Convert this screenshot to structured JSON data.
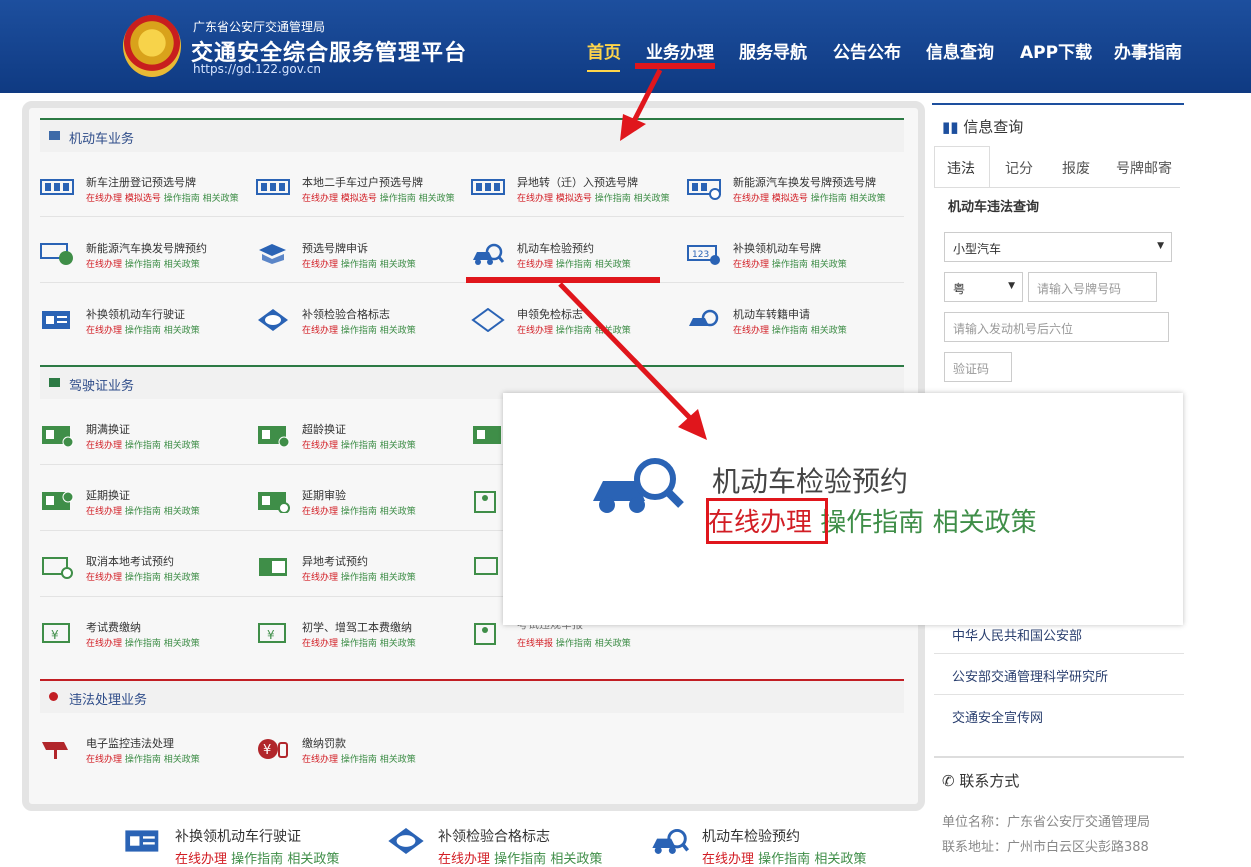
{
  "header": {
    "org": "广东省公安厅交通管理局",
    "title": "交通安全综合服务管理平台",
    "url": "https://gd.122.gov.cn",
    "nav": [
      "首页",
      "业务办理",
      "服务导航",
      "公告公布",
      "信息查询",
      "APP下载",
      "办事指南"
    ]
  },
  "sections": {
    "vehicle": "机动车业务",
    "license": "驾驶证业务",
    "violation": "违法处理业务"
  },
  "links": {
    "online": "在线办理",
    "sim": "模拟选号",
    "guide": "操作指南",
    "policy": "相关政策",
    "report": "在线举报"
  },
  "vehicle_items": [
    "新车注册登记预选号牌",
    "本地二手车过户预选号牌",
    "异地转（迁）入预选号牌",
    "新能源汽车换发号牌预选号牌",
    "新能源汽车换发号牌预约",
    "预选号牌申诉",
    "机动车检验预约",
    "补换领机动车号牌",
    "补换领机动车行驶证",
    "补领检验合格标志",
    "申领免检标志",
    "机动车转籍申请"
  ],
  "license_items": [
    "期满换证",
    "超龄换证",
    "延期换证",
    "延期审验",
    "取消本地考试预约",
    "异地考试预约",
    "考试费缴纳",
    "初学、增驾工本费缴纳",
    "考试违规举报"
  ],
  "violation_items": [
    "电子监控违法处理",
    "缴纳罚款"
  ],
  "zoom": {
    "title": "机动车检验预约",
    "online": "在线办理",
    "guide": "操作指南",
    "policy": "相关政策"
  },
  "sidebar": {
    "title": "信息查询",
    "tabs": [
      "违法",
      "记分",
      "报废",
      "号牌邮寄"
    ],
    "query_title": "机动车违法查询",
    "vehicle_type": "小型汽车",
    "province": "粤",
    "plate_placeholder": "请输入号牌号码",
    "engine_placeholder": "请输入发动机号后六位",
    "captcha_placeholder": "验证码",
    "links": [
      "中华人民共和国公安部",
      "公安部交通管理科学研究所",
      "交通安全宣传网"
    ],
    "contact_title": "联系方式",
    "unit": "单位名称：广东省公安厅交通管理局",
    "address": "联系地址：广州市白云区尖彭路388"
  },
  "bottom_items": [
    "补换领机动车行驶证",
    "补领检验合格标志",
    "机动车检验预约"
  ],
  "colors": {
    "header": "#1d4f9e",
    "nav_active": "#ffd54a",
    "link_red": "#d21d24",
    "link_green": "#3f8e48",
    "arrow": "#e0161c"
  }
}
